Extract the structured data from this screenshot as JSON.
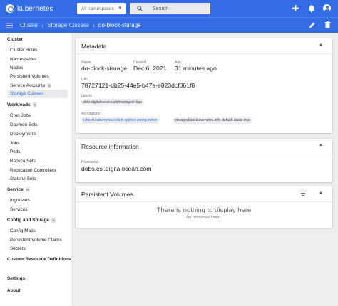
{
  "header": {
    "brand": "kubernetes",
    "namespace": "All namespaces",
    "search_placeholder": "Search"
  },
  "breadcrumb": {
    "items": [
      "Cluster",
      "Storage Classes",
      "do-block-storage"
    ]
  },
  "sidebar": {
    "cluster": {
      "heading": "Cluster",
      "items": [
        "Cluster Roles",
        "Namespaces",
        "Nodes",
        "Persistent Volumes",
        "Service Accounts",
        "Storage Classes"
      ],
      "service_accounts_badge": "N"
    },
    "workloads": {
      "heading": "Workloads",
      "badge": "N",
      "items": [
        "Cron Jobs",
        "Daemon Sets",
        "Deployments",
        "Jobs",
        "Pods",
        "Replica Sets",
        "Replication Controllers",
        "Stateful Sets"
      ]
    },
    "service": {
      "heading": "Service",
      "badge": "N",
      "items": [
        "Ingresses",
        "Services"
      ]
    },
    "config": {
      "heading": "Config and Storage",
      "badge": "N",
      "items": [
        "Config Maps",
        "Persistent Volume Claims",
        "Secrets"
      ]
    },
    "crd": {
      "heading": "Custom Resource Definitions"
    },
    "settings": "Settings",
    "about": "About"
  },
  "metadata": {
    "title": "Metadata",
    "name_label": "Name",
    "name": "do-block-storage",
    "created_label": "Created",
    "created": "Dec 6, 2021",
    "age_label": "Age",
    "age": "31 minutes ago",
    "uid_label": "UID",
    "uid": "78727121-db25-44e5-b47a-e823dcf061f8",
    "labels_label": "Labels",
    "labels": [
      "doks.digitalocean.com/managed: true"
    ],
    "annotations_label": "Annotations",
    "annotations": [
      "kubectl.kubernetes.io/last-applied-configuration",
      "storageclass.kubernetes.io/is-default-class: true"
    ]
  },
  "resource_info": {
    "title": "Resource information",
    "provisioner_label": "Provisioner",
    "provisioner": "dobs.csi.digitalocean.com"
  },
  "persistent_volumes": {
    "title": "Persistent Volumes",
    "empty_title": "There is nothing to display here",
    "empty_subtitle": "No resources found."
  },
  "colors": {
    "primary": "#326ce5",
    "active_text": "#326ce5"
  }
}
